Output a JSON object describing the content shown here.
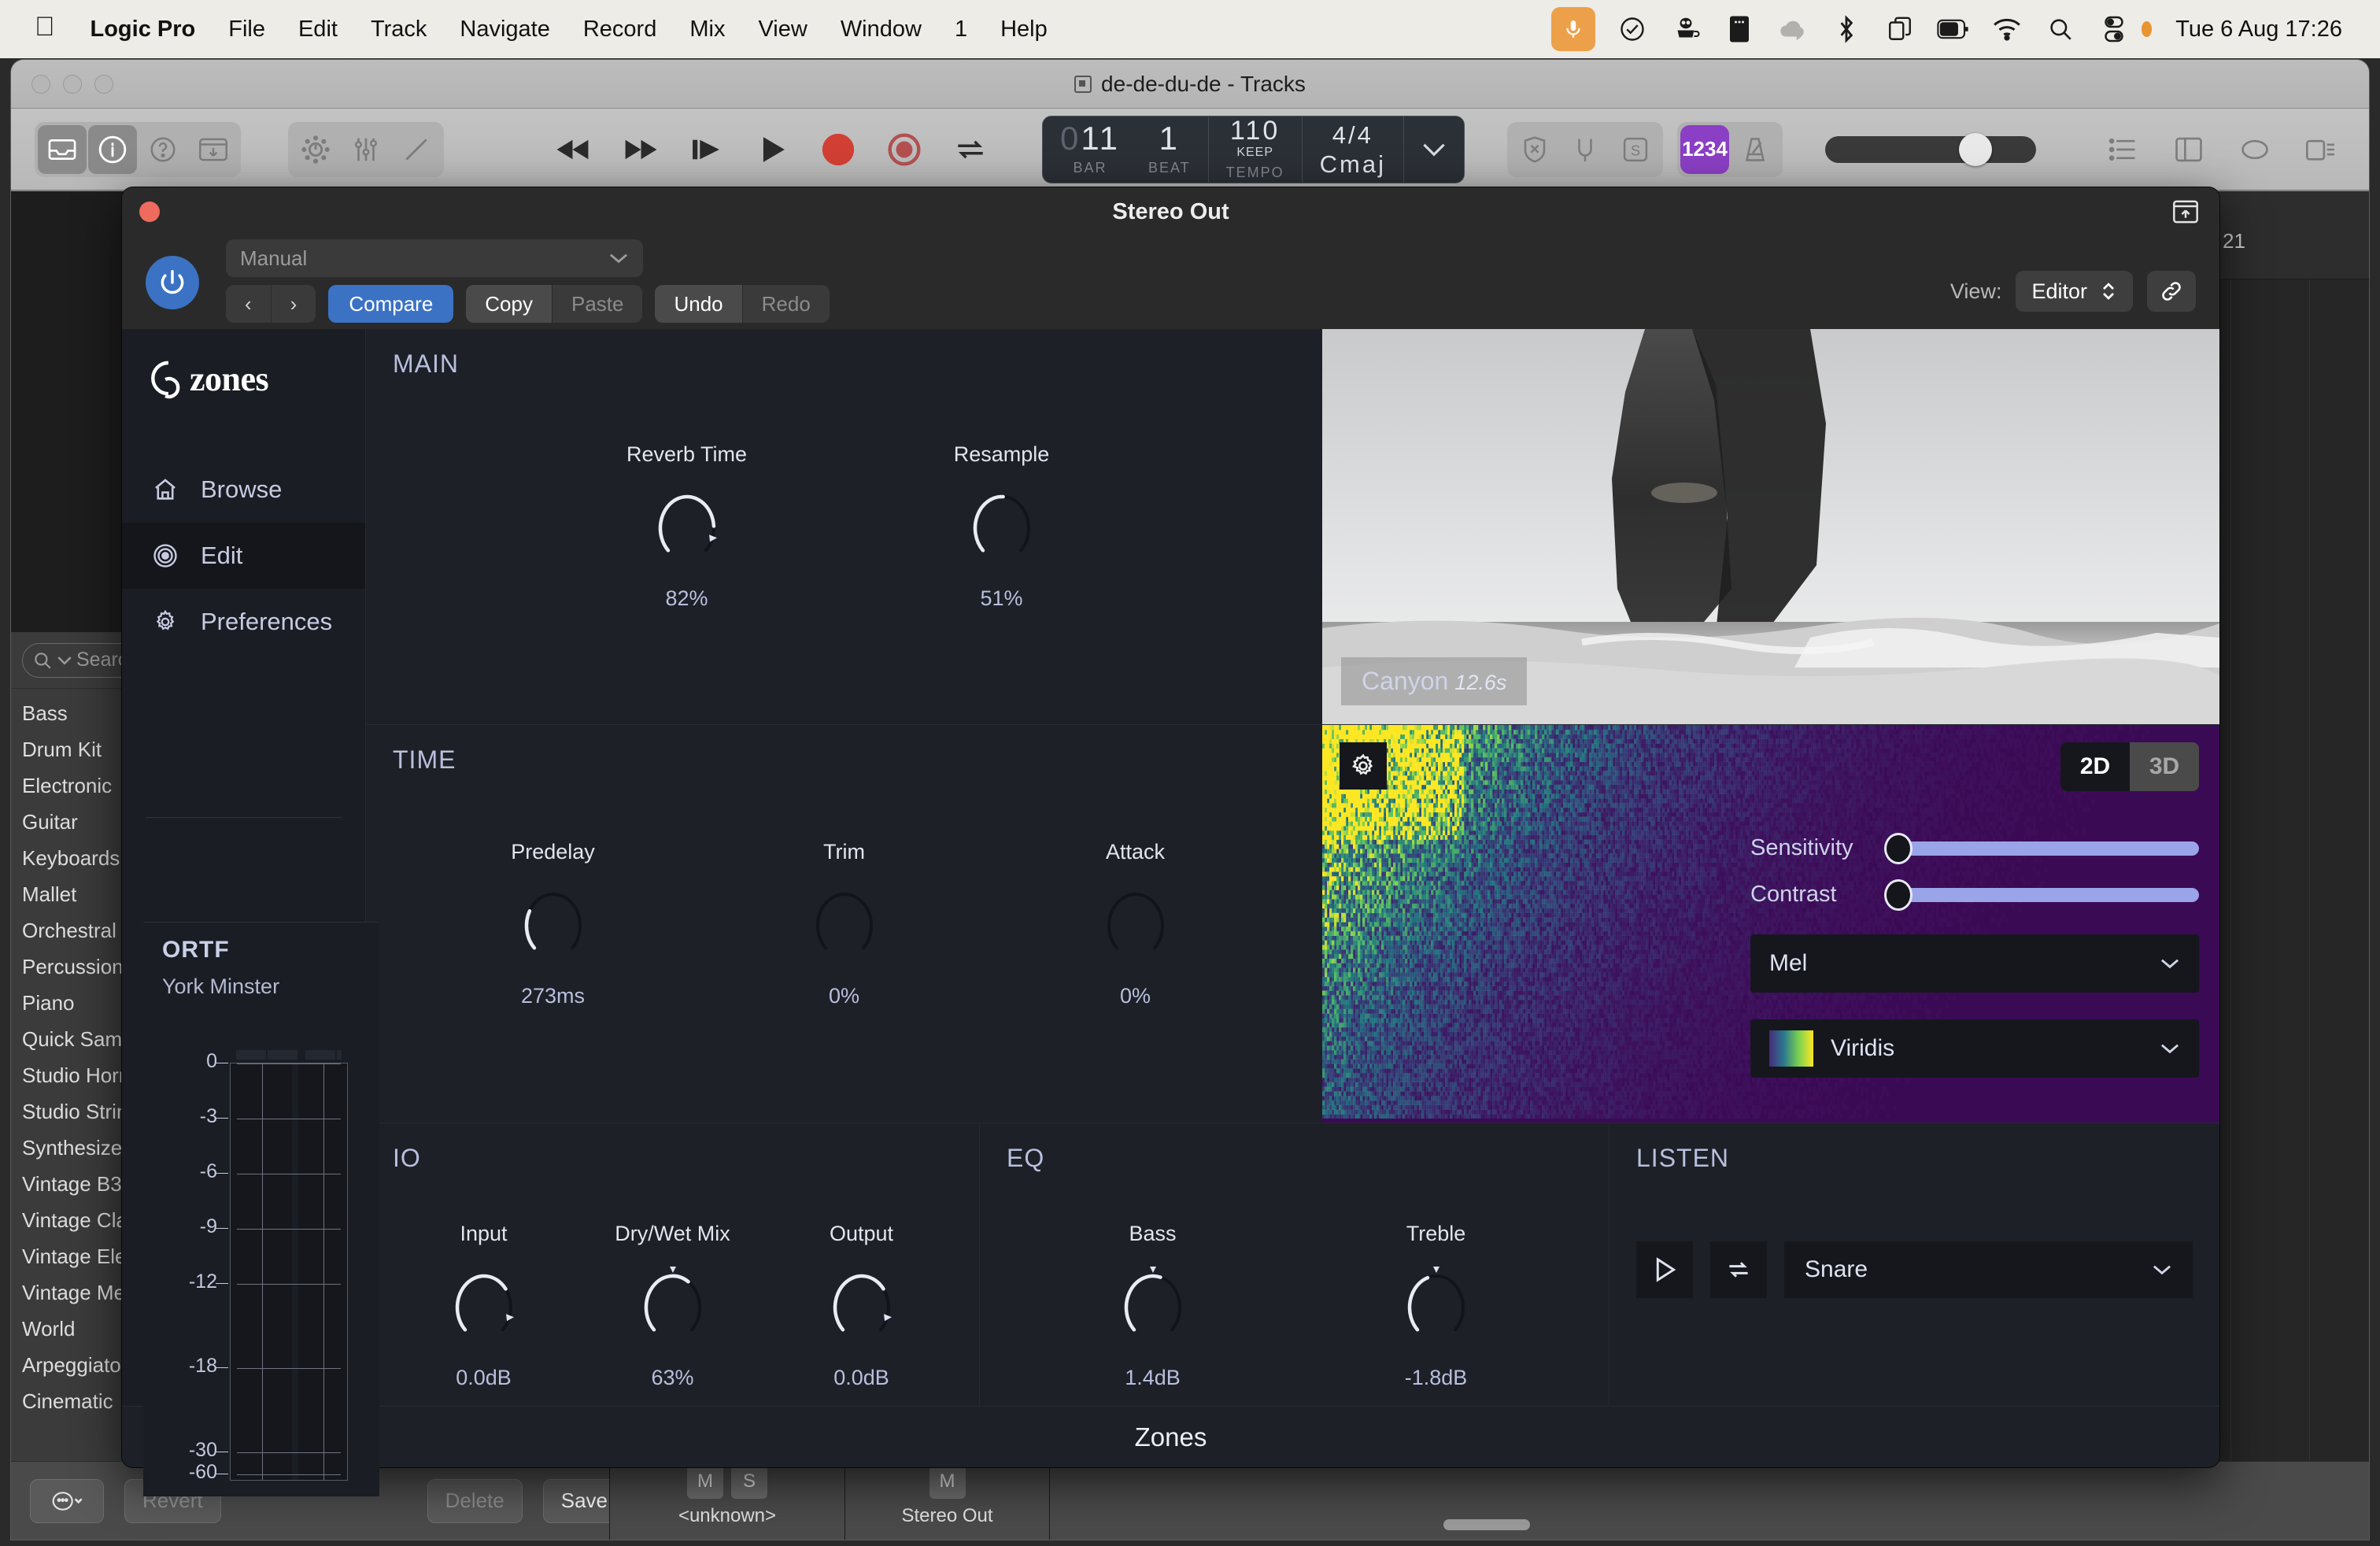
{
  "menubar": {
    "apple": "",
    "items": [
      "Logic Pro",
      "File",
      "Edit",
      "Track",
      "Navigate",
      "Record",
      "Mix",
      "View",
      "Window",
      "1",
      "Help"
    ],
    "clock": "Tue 6 Aug  17:26",
    "status_icons": [
      "microphone-icon",
      "checkmark-circle-icon",
      "owl-coffee-icon",
      "notes-icon",
      "cloud-upload-icon",
      "bluetooth-icon",
      "screen-mirroring-icon",
      "battery-icon",
      "wifi-icon",
      "search-icon",
      "control-center-icon"
    ]
  },
  "logic_window": {
    "title": "de-de-du-de - Tracks",
    "toolbar": {
      "left_icons": [
        "library-icon",
        "info-icon",
        "help-icon",
        "download-icon"
      ],
      "tool_icons": [
        "smart-controls-icon",
        "mixer-icon",
        "editor-pencil-icon"
      ],
      "transport": [
        "rewind-icon",
        "fast-forward-icon",
        "go-to-start-icon",
        "play-icon",
        "record-icon",
        "record-repeat-icon",
        "cycle-icon"
      ],
      "right_icons": [
        "no-click-icon",
        "tuner-icon",
        "solo-icon",
        "metronome-icon"
      ],
      "count_in_label": "1234",
      "view_icons": [
        "list-editors-icon",
        "notepad-icon",
        "loop-browser-icon",
        "browser-icon"
      ]
    },
    "lcd": {
      "bar_leading_zero": "0",
      "bar": "11",
      "beat": "1",
      "bar_label": "BAR",
      "beat_label": "BEAT",
      "tempo": "110",
      "tempo_keep": "KEEP",
      "tempo_label": "TEMPO",
      "signature": "4/4",
      "key": "Cmaj"
    },
    "library": {
      "search_placeholder": "Search",
      "items": [
        "Bass",
        "Drum Kit",
        "Electronic",
        "Guitar",
        "Keyboards",
        "Mallet",
        "Orchestral",
        "Percussion",
        "Piano",
        "Quick Sampler",
        "Studio Horns",
        "Studio Strings",
        "Synthesizer",
        "Vintage B3",
        "Vintage Clav",
        "Vintage Electric",
        "Vintage Mellotron",
        "World",
        "Arpeggiator",
        "Cinematic"
      ]
    },
    "ruler": {
      "bar_number": "21"
    },
    "bottom_bar": {
      "menu_icon": "more-options-icon",
      "revert": "Revert",
      "delete": "Delete",
      "save": "Save...",
      "channel_1": {
        "name": "<unknown>",
        "mute": "M",
        "solo": "S"
      },
      "channel_2": {
        "name": "Stereo Out",
        "mute": "M"
      }
    }
  },
  "plugin": {
    "window_title": "Stereo Out",
    "footer_title": "Zones",
    "brand": "zones",
    "preset": {
      "value": "Manual",
      "chevron": "chevron-down-icon"
    },
    "toolbar_buttons": {
      "prev": "‹",
      "next": "›",
      "compare": "Compare",
      "copy": "Copy",
      "paste": "Paste",
      "undo": "Undo",
      "redo": "Redo"
    },
    "view": {
      "label": "View:",
      "value": "Editor",
      "link_icon": "link-icon"
    },
    "sidebar": {
      "items": [
        {
          "label": "Browse",
          "icon": "home-icon",
          "active": false
        },
        {
          "label": "Edit",
          "icon": "target-icon",
          "active": true
        },
        {
          "label": "Preferences",
          "icon": "gear-icon",
          "active": false
        }
      ]
    },
    "ir_meter": {
      "title": "ORTF",
      "subtitle": "York Minster",
      "scale": [
        "0",
        "-3",
        "-6",
        "-9",
        "-12",
        "-18",
        "-30",
        "-60"
      ]
    },
    "main_section": {
      "title": "MAIN",
      "knobs": [
        {
          "label": "Reverb Time",
          "value": "82%",
          "pct": 82
        },
        {
          "label": "Resample",
          "value": "51%",
          "pct": 51
        }
      ]
    },
    "time_section": {
      "title": "TIME",
      "knobs": [
        {
          "label": "Predelay",
          "value": "273ms",
          "pct": 27
        },
        {
          "label": "Trim",
          "value": "0%",
          "pct": 0
        },
        {
          "label": "Attack",
          "value": "0%",
          "pct": 0
        }
      ]
    },
    "io_section": {
      "title": "IO",
      "knobs": [
        {
          "label": "Input",
          "value": "0.0dB",
          "pct": 70,
          "center": false
        },
        {
          "label": "Dry/Wet Mix",
          "value": "63%",
          "pct": 63,
          "center": true
        },
        {
          "label": "Output",
          "value": "0.0dB",
          "pct": 70,
          "center": false
        }
      ]
    },
    "eq_section": {
      "title": "EQ",
      "knobs": [
        {
          "label": "Bass",
          "value": "1.4dB",
          "pct": 56,
          "center": true
        },
        {
          "label": "Treble",
          "value": "-1.8dB",
          "pct": 43,
          "center": true
        }
      ]
    },
    "listen_section": {
      "title": "LISTEN",
      "play_icon": "play-icon",
      "loop_icon": "loop-icon",
      "source": "Snare",
      "grip_icon": "resize-grip-icon"
    },
    "image_panel": {
      "caption_name": "Canyon",
      "caption_time": "12.6s",
      "alt": "black and white sea stack photograph"
    },
    "spectrogram": {
      "gear_icon": "gear-icon",
      "dimension_modes": [
        "2D",
        "3D"
      ],
      "active_mode": "2D",
      "sliders": [
        {
          "label": "Sensitivity",
          "value": 0
        },
        {
          "label": "Contrast",
          "value": 0
        }
      ],
      "scale_select": "Mel",
      "colormap_select": "Viridis"
    }
  },
  "colors": {
    "accent_blue": "#3b72c4",
    "plugin_bg": "#1d2027",
    "sidebar_bg": "#1a1d24",
    "spectrogram_bg": "#3b0a55",
    "slider_fill": "#9aa4e8",
    "menubar_bg": "#edece7",
    "mic_orange": "#eda04a",
    "purple_chip": "#8b3fc4",
    "region_green": "#2fbf4a"
  }
}
